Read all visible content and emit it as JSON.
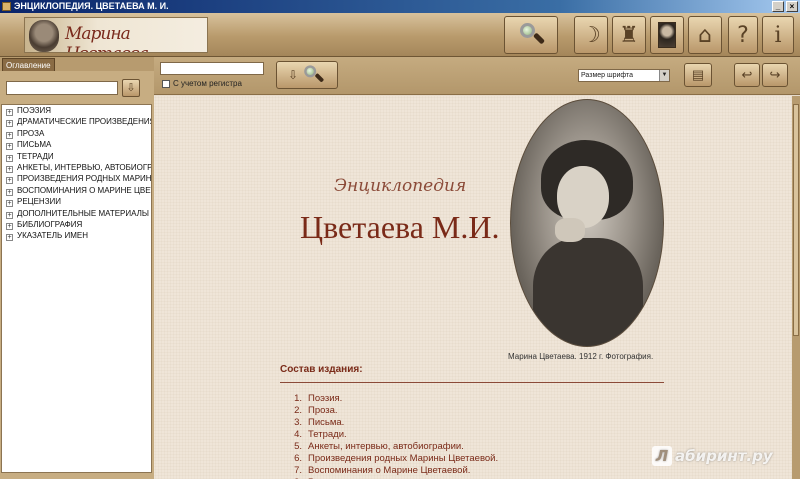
{
  "window": {
    "title": "ЭНЦИКЛОПЕДИЯ. ЦВЕТАЕВА М. И.",
    "minimize": "_",
    "close": "×"
  },
  "toolbar": {
    "logo_signature": "Марина Цветаева",
    "icons": [
      "search-icon",
      "mask-icon",
      "monument-icon",
      "portrait-icon",
      "book-icon",
      "help-icon",
      "info-icon"
    ],
    "help_label": "?",
    "info_label": "i"
  },
  "sidebar": {
    "tab_label": "Оглавление",
    "search_value": "",
    "go_glyph": "⇩",
    "items": [
      {
        "label": "ПОЭЗИЯ"
      },
      {
        "label": "ДРАМАТИЧЕСКИЕ ПРОИЗВЕДЕНИЯ"
      },
      {
        "label": "ПРОЗА"
      },
      {
        "label": "ПИСЬМА"
      },
      {
        "label": "ТЕТРАДИ"
      },
      {
        "label": "АНКЕТЫ, ИНТЕРВЬЮ, АВТОБИОГРА"
      },
      {
        "label": "ПРОИЗВЕДЕНИЯ РОДНЫХ МАРИНЫ"
      },
      {
        "label": "ВОСПОМИНАНИЯ О МАРИНЕ ЦВЕТ"
      },
      {
        "label": "РЕЦЕНЗИИ"
      },
      {
        "label": "ДОПОЛНИТЕЛЬНЫЕ МАТЕРИАЛЫ"
      },
      {
        "label": "БИБЛИОГРАФИЯ"
      },
      {
        "label": "УКАЗАТЕЛЬ ИМЕН"
      }
    ],
    "expander": "+"
  },
  "main_toolbar": {
    "search_value": "",
    "case_label": "С учетом регистра",
    "font_size_selected": "Размер шрифта",
    "find_arrow": "⇩",
    "print_glyph": "▤",
    "back_glyph": "↩",
    "forward_glyph": "↪"
  },
  "content": {
    "subtitle": "Энциклопедия",
    "title": "Цветаева М.И.",
    "photo_caption": "Марина Цветаева. 1912 г. Фотография.",
    "section_title": "Состав издания:",
    "toc": [
      {
        "num": "1.",
        "text": "Поэзия."
      },
      {
        "num": "2.",
        "text": "Проза."
      },
      {
        "num": "3.",
        "text": "Письма."
      },
      {
        "num": "4.",
        "text": "Тетради."
      },
      {
        "num": "5.",
        "text": "Анкеты, интервью, автобиографии."
      },
      {
        "num": "6.",
        "text": "Произведения родных Марины Цветаевой."
      },
      {
        "num": "7.",
        "text": "Воспоминания о Марине Цветаевой."
      },
      {
        "num": "8.",
        "text": "Рецензии."
      }
    ]
  },
  "watermark": {
    "letter": "Л",
    "text": "абиринт.ру"
  }
}
